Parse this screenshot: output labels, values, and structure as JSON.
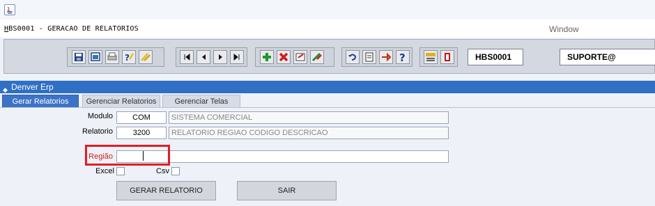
{
  "window": {
    "caption_prefix": "H",
    "caption_rest": "BS0001 - GERACAO DE RELATORIOS",
    "menu_window": "Window"
  },
  "toolbar": {
    "form_code": "HBS0001",
    "user": "SUPORTE@"
  },
  "panel": {
    "title": "Denver Erp"
  },
  "tabs": [
    {
      "label": "Gerar Relatorios",
      "active": true
    },
    {
      "label": "Gerenciar Relatorios",
      "active": false
    },
    {
      "label": "Gerenciar Telas",
      "active": false
    }
  ],
  "form": {
    "modulo_label": "Modulo",
    "modulo_code": "COM",
    "modulo_desc": "SISTEMA COMERCIAL",
    "relatorio_label": "Relatorio",
    "relatorio_code": "3200",
    "relatorio_desc": "RELATORIO REGIAO CODIGO DESCRICAO",
    "regiao_label": "Região",
    "regiao_value": "",
    "excel_label": "Excel",
    "csv_label": "Csv",
    "generate_button": "GERAR RELATORIO",
    "exit_button": "SAIR"
  },
  "colors": {
    "panel_bar": "#2f6fc4",
    "active_tab": "#3c73c6",
    "highlight": "#e51c23",
    "regiao_label": "#d0201a"
  }
}
